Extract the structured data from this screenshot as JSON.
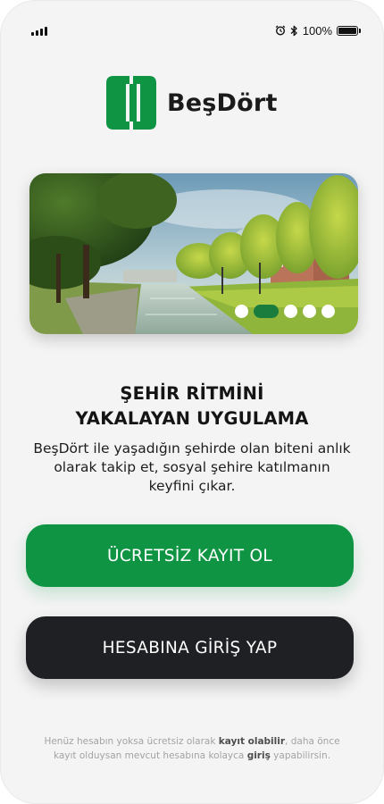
{
  "status_bar": {
    "battery_text": "100%",
    "battery_level": 1.0,
    "icons": [
      "signal-icon",
      "alarm-icon",
      "bluetooth-icon",
      "battery-icon"
    ]
  },
  "brand": {
    "name": "BeşDört",
    "colors": {
      "primary": "#0f9444",
      "dark": "#1f2024"
    }
  },
  "carousel": {
    "slide_count": 5,
    "active_index": 1
  },
  "headline": {
    "line1": "ŞEHİR RİTMİNİ",
    "line2": "YAKALAYAN UYGULAMA"
  },
  "description": "BeşDört ile yaşadığın şehirde olan biteni anlık olarak takip et, sosyal şehire katılmanın keyfini çıkar.",
  "buttons": {
    "register": "ÜCRETSİZ KAYIT OL",
    "login": "HESABINA GİRİŞ YAP"
  },
  "footer": {
    "part1": "Henüz hesabın yoksa ücretsiz olarak ",
    "register_link": "kayıt olabilir",
    "part2": ", daha önce kayıt olduysan mevcut hesabına kolayca ",
    "login_link": "giriş",
    "part3": " yapabilirsin."
  }
}
